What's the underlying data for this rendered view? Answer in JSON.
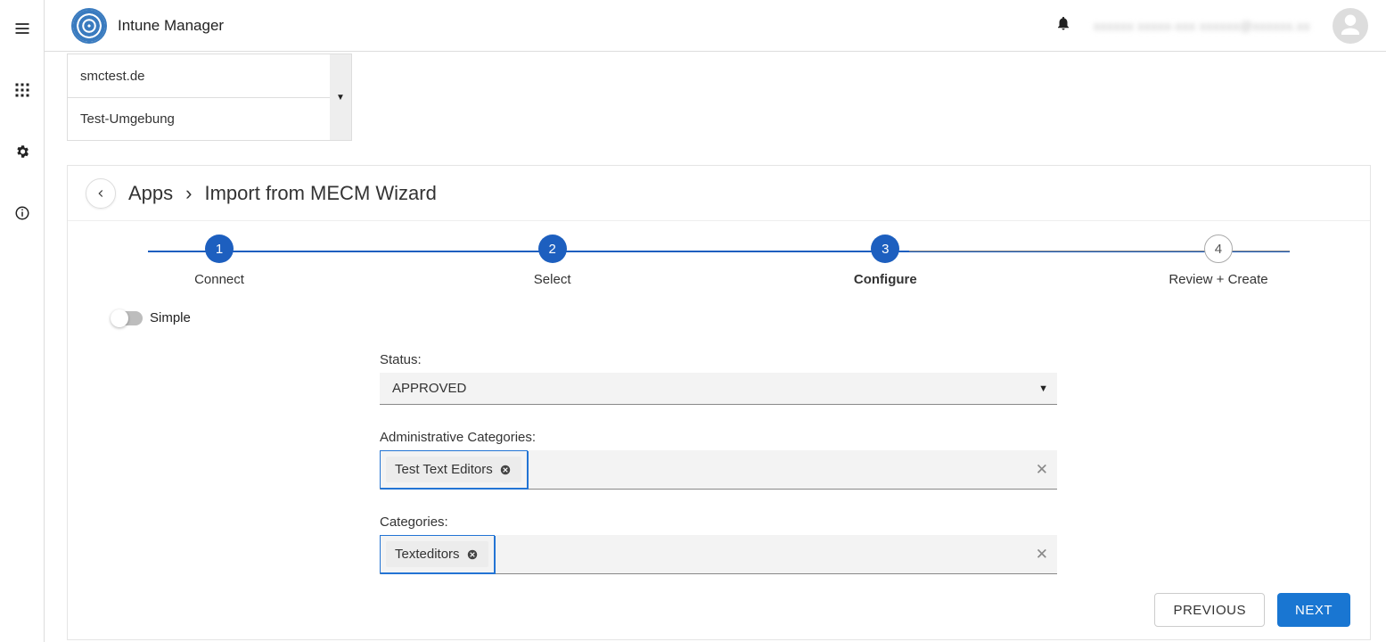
{
  "app": {
    "title": "Intune Manager",
    "user_display": "xxxxxx xxxxx-xxx xxxxxx@xxxxxx.xx"
  },
  "tenant": {
    "line1": "smctest.de",
    "line2": "Test-Umgebung"
  },
  "breadcrumb": {
    "root": "Apps",
    "current": "Import from MECM Wizard"
  },
  "stepper": {
    "steps": [
      {
        "num": "1",
        "label": "Connect"
      },
      {
        "num": "2",
        "label": "Select"
      },
      {
        "num": "3",
        "label": "Configure"
      },
      {
        "num": "4",
        "label": "Review + Create"
      }
    ],
    "active_index": 2
  },
  "toggle": {
    "label": "Simple",
    "on": false
  },
  "form": {
    "status_label": "Status:",
    "status_value": "APPROVED",
    "admin_cat_label": "Administrative Categories:",
    "admin_cat_chips": [
      "Test Text Editors"
    ],
    "cat_label": "Categories:",
    "cat_chips": [
      "Texteditors"
    ]
  },
  "buttons": {
    "previous": "PREVIOUS",
    "next": "NEXT"
  }
}
